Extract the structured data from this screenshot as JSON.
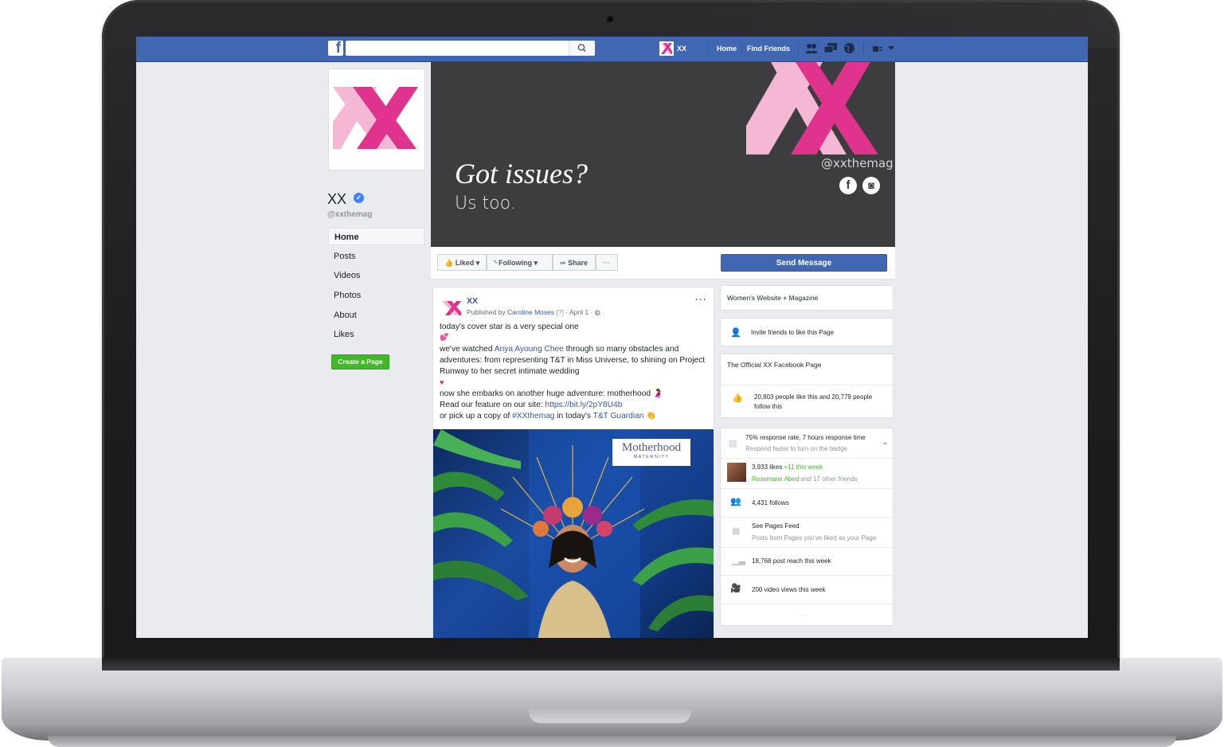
{
  "topbar": {
    "logo": "f",
    "search_placeholder": "",
    "page_shortcut": "XX",
    "nav": [
      "Home",
      "Find Friends"
    ]
  },
  "page": {
    "name": "XX",
    "handle": "@xxthemag",
    "nav": [
      "Home",
      "Posts",
      "Videos",
      "Photos",
      "About",
      "Likes"
    ],
    "create_page": "Create a Page"
  },
  "cover": {
    "headline": "Got issues?",
    "subline": "Us too.",
    "handle": "@xxthemag",
    "social": [
      "f",
      "◙"
    ]
  },
  "actions": {
    "liked": "Liked",
    "following": "Following",
    "share": "Share",
    "more": "···",
    "send_message": "Send Message"
  },
  "post": {
    "author": "XX",
    "published_by": "Published by ",
    "publisher": "Caroline Moses",
    "help": " [?]",
    "date": " · April 1 · ",
    "line1": "today's cover star is a very special one",
    "line2a": "we've watched ",
    "line2_link": "Anya Ayoung Chee",
    "line2b": " through so many obstacles and",
    "line3": "adventures: from representing T&T in Miss Universe, to shining on Project",
    "line4": "Runway to her secret intimate wedding",
    "line5": "now she embarks on another huge adventure: motherhood",
    "line6a": "Read our feature on our site: ",
    "line6_link": "https://bit.ly/2pY8U4b",
    "line7a": "or pick up a copy of ",
    "line7_tag": "#XXthemag",
    "line7b": " in today's ",
    "line7_link": "T&T Guardian",
    "image_title": "Motherhood",
    "image_sub": "MATERNITY"
  },
  "sidebar": {
    "category": "Women's Website + Magazine",
    "invite": "Invite friends to like this Page",
    "official": "The Official XX Facebook Page",
    "likes_line1": "20,803 people like this and 20,779 people",
    "likes_line2": "follow this",
    "response": "75% response rate, 7 hours response time",
    "response_sub": "Respond faster to turn on the badge",
    "likes_count": "3,933 likes ",
    "likes_week": "+11 this week",
    "friends_name": "Rosemarie Abed",
    "friends_rest": " and 17 other friends",
    "follows": "4,431 follows",
    "pages_feed": "See Pages Feed",
    "pages_feed_sub": "Posts from Pages you've liked as your Page",
    "reach": "18,768 post reach this week",
    "video_views": "200 video views this week",
    "more": "···"
  },
  "colors": {
    "facebook_blue": "#4267b2",
    "brand_pink": "#e0338e",
    "brand_light_pink": "#f4b8d4",
    "cover_bg": "#3d3d3f",
    "link": "#385898",
    "green": "#42b72a"
  }
}
